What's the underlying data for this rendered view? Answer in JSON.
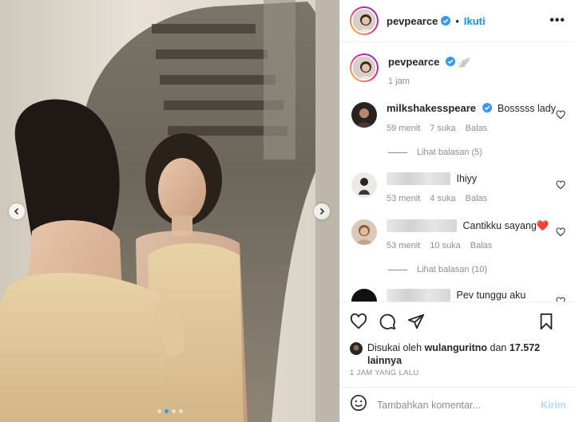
{
  "post": {
    "author": "pevpearce",
    "follow_label": "Ikuti",
    "separator": "•",
    "more_label": "•••",
    "carousel_dots": 4,
    "carousel_active": 1
  },
  "caption": {
    "username": "pevpearce",
    "emoji": "🪽",
    "time": "1 jam"
  },
  "comments": [
    {
      "username": "milkshakesspeare",
      "verified": true,
      "text": "Bosssss lady",
      "time": "59 menit",
      "likes": "7 suka",
      "reply": "Balas",
      "view_replies": "Lihat balasan (5)"
    },
    {
      "username": "",
      "text": "Ihiyy",
      "time": "53 menit",
      "likes": "4 suka",
      "reply": "Balas"
    },
    {
      "username": "",
      "text": "Cantikku sayang❤️",
      "time": "53 menit",
      "likes": "10 suka",
      "reply": "Balas",
      "view_replies": "Lihat balasan (10)"
    },
    {
      "username": "",
      "text": "Pev tunggu aku"
    }
  ],
  "likes": {
    "prefix": "Disukai oleh",
    "user": "wulanguritno",
    "middle": "dan",
    "count": "17.572",
    "suffix": "lainnya"
  },
  "time_ago": "1 JAM YANG LALU",
  "add_comment": {
    "placeholder": "Tambahkan komentar...",
    "send_label": "Kirim"
  },
  "colors": {
    "accent": "#0095f6",
    "verified": "#3897f0",
    "send_disabled": "#b3dbff",
    "active_dot": "#3897f0"
  },
  "icons": [
    "chevron-left-icon",
    "chevron-right-icon",
    "verified-badge-icon",
    "heart-icon",
    "comment-icon",
    "share-icon",
    "bookmark-icon",
    "emoji-icon"
  ]
}
